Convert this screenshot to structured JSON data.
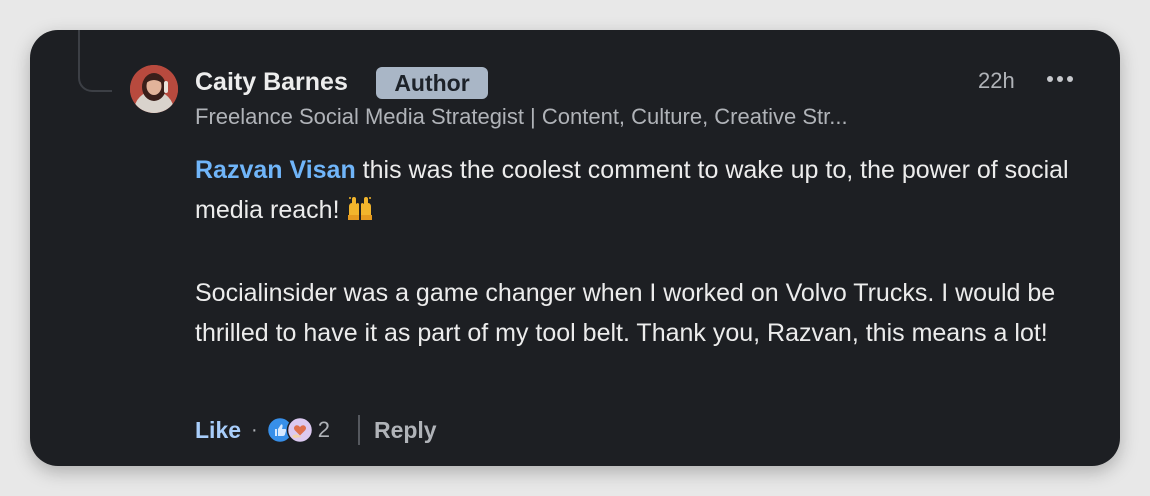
{
  "comment": {
    "author": {
      "name": "Caity Barnes",
      "badge": "Author",
      "headline": "Freelance Social Media Strategist | Content, Culture, Creative Str..."
    },
    "timestamp": "22h",
    "more_icon": "more-horizontal-icon",
    "body": {
      "mention": "Razvan Visan",
      "line1_rest": " this was the coolest comment to wake up to, the power of social media reach!",
      "emoji": "raising-hands-emoji",
      "paragraph2": "Socialinsider was a game changer when I worked on Volvo Trucks. I would be thrilled to have it as part of my tool belt. Thank you, Razvan, this means a lot!"
    },
    "actions": {
      "like_label": "Like",
      "separator": "·",
      "reaction_icons": [
        "like-reaction-icon",
        "love-reaction-icon"
      ],
      "reaction_count": "2",
      "reply_label": "Reply"
    }
  },
  "colors": {
    "card_background": "#1d1f23",
    "page_background": "#e8e8e8",
    "mention": "#70b5f9",
    "like": "#a8cdfa",
    "badge_background": "#a9b6c6",
    "muted_text": "#b0b3b8"
  }
}
